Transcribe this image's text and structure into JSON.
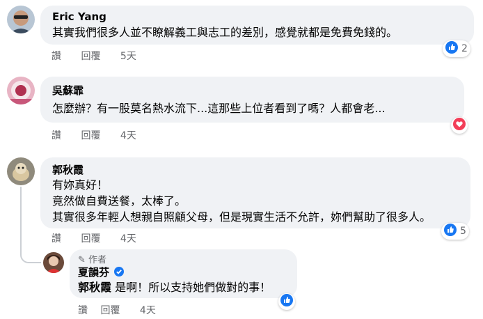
{
  "comments": [
    {
      "author": "Eric Yang",
      "text": "其實我們很多人並不瞭解義工與志工的差別，感覺就都是免費免錢的。",
      "actions": {
        "like": "讚",
        "reply": "回覆",
        "time": "5天"
      },
      "reaction": {
        "type": "like",
        "count": "2"
      }
    },
    {
      "author": "吳蘇霏",
      "text": "怎麼辦？有一股莫名熱水流下...這那些上位者看到了嗎？人都會老...",
      "actions": {
        "like": "讚",
        "reply": "回覆",
        "time": "4天"
      },
      "reaction": {
        "type": "love",
        "count": ""
      }
    },
    {
      "author": "郭秋霞",
      "lines": [
        "有妳真好！",
        "竟然做自費送餐，太棒了。",
        "其實很多年輕人想親自照顧父母，但是現實生活不允許，妳們幫助了很多人。"
      ],
      "actions": {
        "like": "讚",
        "reply": "回覆",
        "time": "4天"
      },
      "reaction": {
        "type": "like",
        "count": "5"
      }
    }
  ],
  "reply": {
    "author_badge": "作者",
    "author": "夏韻芬",
    "mention": "郭秋霞",
    "text": " 是啊！所以支持她們做對的事！",
    "actions": {
      "like": "讚",
      "reply": "回覆",
      "time": "4天"
    },
    "reaction": {
      "type": "like",
      "count": ""
    }
  },
  "colors": {
    "bubble": "#f0f2f5",
    "like_blue": "#1877f2",
    "love_red": "#f33e58",
    "muted": "#65676b"
  }
}
